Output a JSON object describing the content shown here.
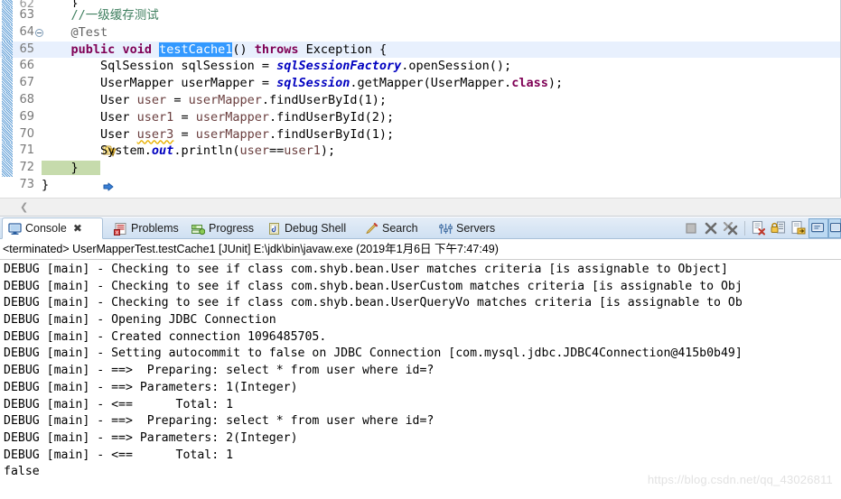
{
  "editor": {
    "lines": [
      {
        "num": "62",
        "partial": true,
        "code_plain": "    }"
      },
      {
        "num": "63",
        "code_plain": "    //一级缓存测试"
      },
      {
        "num": "64",
        "fold": true,
        "code_plain": "    @Test"
      },
      {
        "num": "65",
        "highlight": true,
        "code_plain": "    public void testCache1() throws Exception {"
      },
      {
        "num": "66",
        "code_plain": "        SqlSession sqlSession = sqlSessionFactory.openSession();"
      },
      {
        "num": "67",
        "code_plain": "        UserMapper userMapper = sqlSession.getMapper(UserMapper.class);"
      },
      {
        "num": "68",
        "code_plain": "        User user = userMapper.findUserById(1);"
      },
      {
        "num": "69",
        "code_plain": "        User user1 = userMapper.findUserById(2);"
      },
      {
        "num": "70",
        "marker": "warning-icon",
        "code_plain": "        User user3 = userMapper.findUserById(1);"
      },
      {
        "num": "71",
        "code_plain": "        System.out.println(user==user1);"
      },
      {
        "num": "72",
        "marker": "current-instruction-pointer-icon",
        "code_plain": "    }"
      },
      {
        "num": "73",
        "code_plain": "}"
      }
    ],
    "selected_text": "testCache1",
    "colors": {
      "keyword": "#7F0055",
      "comment": "#3F7F5F",
      "static_field": "#0000C0",
      "local_variable": "#6A3E3E",
      "selection_background": "#3399FF",
      "current_line_background": "#E8F0FD",
      "block_highlight": "#C6DBAC"
    }
  },
  "console_view": {
    "tabs": [
      {
        "label": "Console",
        "icon": "console-icon",
        "active": true,
        "closeable": true,
        "close_glyph": "✖"
      },
      {
        "label": "Problems",
        "icon": "problems-icon",
        "active": false
      },
      {
        "label": "Progress",
        "icon": "progress-icon",
        "active": false
      },
      {
        "label": "Debug Shell",
        "icon": "debug-shell-icon",
        "active": false
      },
      {
        "label": "Search",
        "icon": "search-icon",
        "active": false
      },
      {
        "label": "Servers",
        "icon": "servers-icon",
        "active": false
      }
    ],
    "toolbar": [
      {
        "name": "terminate-button",
        "title": "Terminate",
        "enabled": false
      },
      {
        "name": "remove-launch-button",
        "title": "Remove Launch"
      },
      {
        "name": "remove-all-terminated-button",
        "title": "Remove All Terminated Launches"
      },
      {
        "name": "separator"
      },
      {
        "name": "clear-console-button",
        "title": "Clear Console"
      },
      {
        "name": "scroll-lock-button",
        "title": "Scroll Lock"
      },
      {
        "name": "pin-console-button",
        "title": "Pin Console"
      },
      {
        "name": "display-selected-console-button",
        "title": "Display Selected Console",
        "active": true
      },
      {
        "name": "open-console-button",
        "title": "Open Console"
      }
    ],
    "process_line": "<terminated> UserMapperTest.testCache1 [JUnit] E:\\jdk\\bin\\javaw.exe (2019年1月6日 下午7:47:49)",
    "log_lines": [
      "DEBUG [main] - Checking to see if class com.shyb.bean.User matches criteria [is assignable to Object]",
      "DEBUG [main] - Checking to see if class com.shyb.bean.UserCustom matches criteria [is assignable to Obj",
      "DEBUG [main] - Checking to see if class com.shyb.bean.UserQueryVo matches criteria [is assignable to Ob",
      "DEBUG [main] - Opening JDBC Connection",
      "DEBUG [main] - Created connection 1096485705.",
      "DEBUG [main] - Setting autocommit to false on JDBC Connection [com.mysql.jdbc.JDBC4Connection@415b0b49]",
      "DEBUG [main] - ==>  Preparing: select * from user where id=?",
      "DEBUG [main] - ==> Parameters: 1(Integer)",
      "DEBUG [main] - <==      Total: 1",
      "DEBUG [main] - ==>  Preparing: select * from user where id=?",
      "DEBUG [main] - ==> Parameters: 2(Integer)",
      "DEBUG [main] - <==      Total: 1",
      "false"
    ]
  },
  "watermark": "https://blog.csdn.net/qq_43026811"
}
